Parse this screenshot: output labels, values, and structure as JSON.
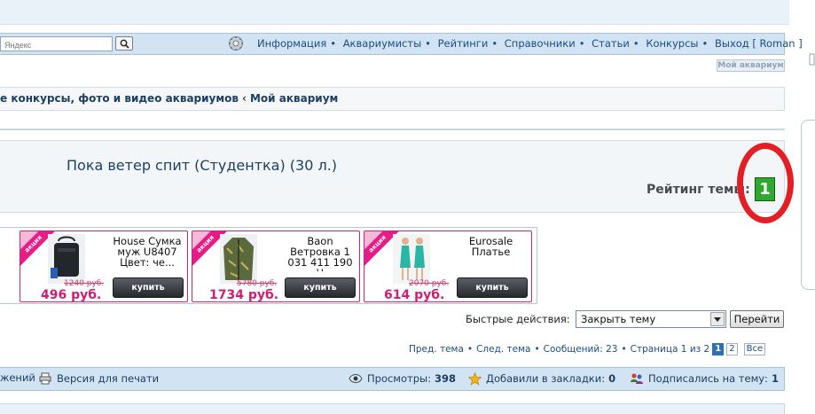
{
  "topnav": {
    "search_placeholder": "Яндекс",
    "links": [
      "Информация",
      "Аквариумисты",
      "Рейтинги",
      "Справочники",
      "Статьи",
      "Конкурсы"
    ],
    "logout_label": "Выход",
    "username": "Roman",
    "my_aquarium_button": "Мой аквариум"
  },
  "breadcrumb": {
    "items": [
      "е конкурсы, фото и видео аквариумов",
      "Мой аквариум"
    ],
    "separator": "‹"
  },
  "thread": {
    "title": "Пока ветер спит (Студентка) (30 л.)",
    "rating_label": "Рейтинг темы:",
    "rating_value": "1"
  },
  "ads": [
    {
      "badge": "акция",
      "name_lines": [
        "House Сумка",
        "муж U8407",
        "Цвет: че..."
      ],
      "old_price": "1240 руб.",
      "price": "496 руб.",
      "buy_label": "купить"
    },
    {
      "badge": "акция",
      "name_lines": [
        "Baon",
        "Ветровка 1",
        "031 411 190",
        "Ц"
      ],
      "old_price": "5780 руб.",
      "price": "1734 руб.",
      "buy_label": "купить"
    },
    {
      "badge": "акция",
      "name_lines": [
        "Eurosale",
        "Платье"
      ],
      "old_price": "2070 руб.",
      "price": "614 руб.",
      "buy_label": "купить"
    }
  ],
  "quick_actions": {
    "label": "Быстрые действия:",
    "selected": "Закрыть тему",
    "go_label": "Перейти"
  },
  "pager": {
    "prev_label": "Пред. тема",
    "next_label": "След. тема",
    "posts_text": "Сообщений: 23",
    "page_text": "Страница 1 из 2",
    "pages": [
      "1",
      "2"
    ],
    "all_label": "Все"
  },
  "tools": {
    "left_fragment": "жений",
    "print_label": "Версия для печати",
    "views_label": "Просмотры:",
    "views_value": "398",
    "bookmarks_label": "Добавили в закладки:",
    "bookmarks_value": "0",
    "subscribers_label": "Подписались на тему:",
    "subscribers_value": "1"
  },
  "colors": {
    "nav_blue": "#d2e3f3",
    "link_blue": "#1a4d86",
    "rating_green": "#2ea82e",
    "annotation_red": "#e31f26",
    "ad_pink": "#d11d74"
  }
}
